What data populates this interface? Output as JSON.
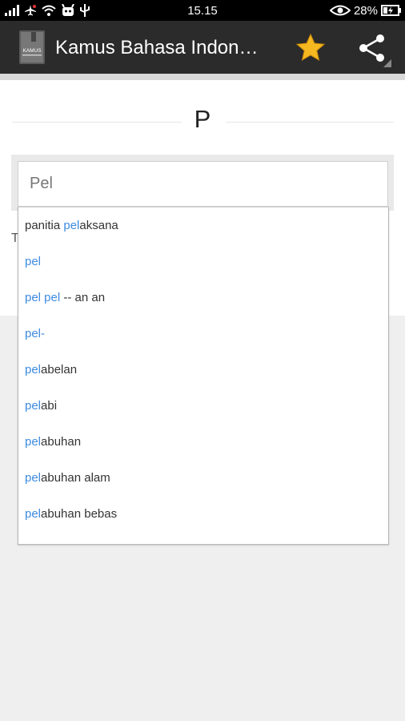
{
  "status_bar": {
    "time": "15.15",
    "battery_percent": "28%"
  },
  "app_bar": {
    "title": "Kamus Bahasa Indon…",
    "logo_text": "KAMUS"
  },
  "section": {
    "letter": "P"
  },
  "search": {
    "value": "Pel"
  },
  "hidden_text": "T",
  "suggestions": [
    {
      "before": "panitia ",
      "match": "pel",
      "after": "aksana"
    },
    {
      "before": "",
      "match": "pel",
      "after": ""
    },
    {
      "before": "",
      "match": "pel pel",
      "after": " -- an an"
    },
    {
      "before": "",
      "match": "pel-",
      "after": ""
    },
    {
      "before": "",
      "match": "pel",
      "after": "abelan"
    },
    {
      "before": "",
      "match": "pel",
      "after": "abi"
    },
    {
      "before": "",
      "match": "pel",
      "after": "abuhan"
    },
    {
      "before": "",
      "match": "pel",
      "after": "abuhan alam"
    },
    {
      "before": "",
      "match": "pel",
      "after": "abuhan bebas"
    }
  ],
  "colors": {
    "highlight": "#3d8be0",
    "star": "#f5b820",
    "app_bar": "#2b2b2b"
  }
}
